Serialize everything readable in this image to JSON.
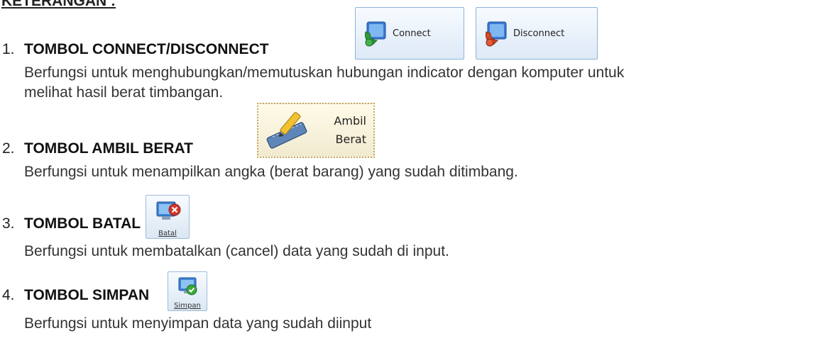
{
  "heading": "KETERANGAN :",
  "items": [
    {
      "num": "1.",
      "title": "TOMBOL CONNECT/DISCONNECT",
      "desc_line1": "Berfungsi untuk menghubungkan/memutuskan hubungan indicator dengan komputer untuk",
      "desc_line2": "melihat hasil berat timbangan.",
      "buttons": [
        {
          "label": "Connect",
          "icon": "network-computer-icon"
        },
        {
          "label": "Disconnect",
          "icon": "network-computer-icon"
        }
      ]
    },
    {
      "num": "2.",
      "title": "TOMBOL AMBIL BERAT",
      "desc": "Berfungsi untuk menampilkan angka (berat barang) yang sudah ditimbang.",
      "button": {
        "line1": "Ambil",
        "line2": "Berat",
        "icon": "pen-ruler-icon"
      }
    },
    {
      "num": "3.",
      "title": "TOMBOL BATAL",
      "desc": "Berfungsi untuk membatalkan (cancel) data yang sudah di input.",
      "button": {
        "label": "Batal",
        "icon": "computer-cancel-icon"
      }
    },
    {
      "num": "4.",
      "title": "TOMBOL SIMPAN",
      "desc": "Berfungsi untuk menyimpan data yang sudah diinput",
      "button": {
        "label": "Simpan",
        "icon": "computer-check-icon"
      }
    }
  ],
  "colors": {
    "button_border": "#8fb3d9",
    "ambil_border": "#c4a86a",
    "cancel_red": "#d9342b",
    "check_green": "#3aa83a"
  }
}
